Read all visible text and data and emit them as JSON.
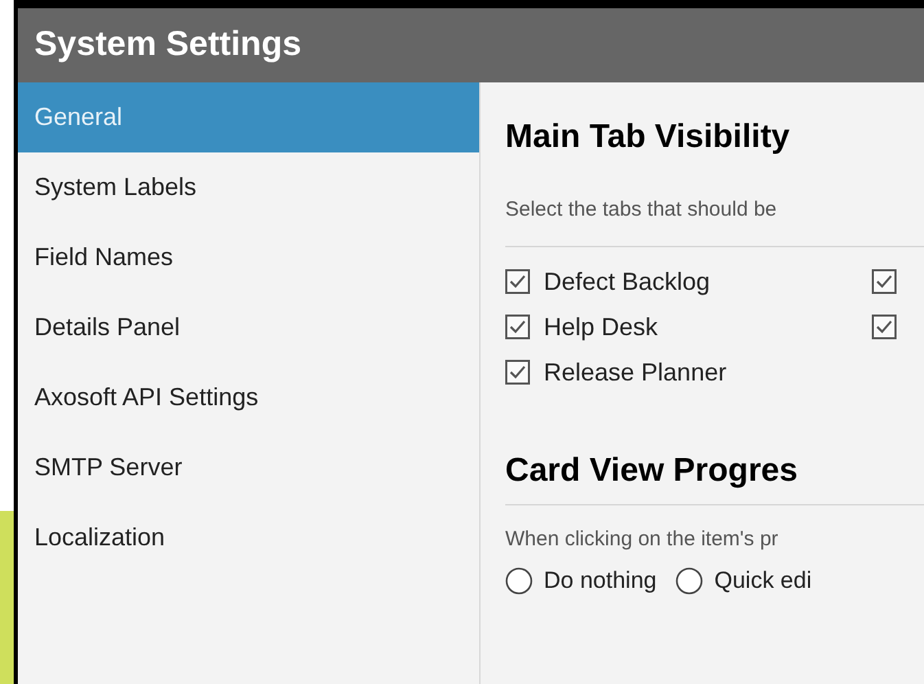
{
  "window": {
    "title": "System Settings"
  },
  "sidebar": {
    "items": [
      {
        "label": "General",
        "selected": true
      },
      {
        "label": "System Labels",
        "selected": false
      },
      {
        "label": "Field Names",
        "selected": false
      },
      {
        "label": "Details Panel",
        "selected": false
      },
      {
        "label": "Axosoft API Settings",
        "selected": false
      },
      {
        "label": "SMTP Server",
        "selected": false
      },
      {
        "label": "Localization",
        "selected": false
      }
    ]
  },
  "sections": [
    {
      "title": "Main Tab Visibility",
      "description": "Select the tabs that should be",
      "checkbox_columns": [
        [
          {
            "label": "Defect Backlog",
            "checked": true
          },
          {
            "label": "Help Desk",
            "checked": true
          },
          {
            "label": "Release Planner",
            "checked": true
          }
        ],
        [
          {
            "checked": true
          },
          {
            "checked": true
          }
        ]
      ]
    },
    {
      "title": "Card View Progres",
      "description": "When clicking on the item's pr",
      "radios": [
        {
          "label": "Do nothing",
          "selected": false
        },
        {
          "label": "Quick edi",
          "selected": false
        }
      ]
    }
  ]
}
